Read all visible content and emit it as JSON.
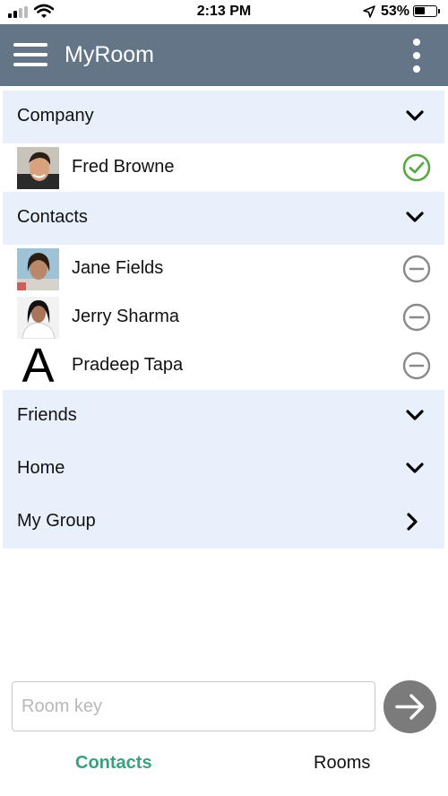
{
  "status_bar": {
    "time": "2:13 PM",
    "battery": "53%",
    "battery_level": 0.53
  },
  "app_bar": {
    "title": "MyRoom",
    "menu_icon": "hamburger-menu-icon",
    "overflow_icon": "more-vertical-icon"
  },
  "groups": [
    {
      "label": "Company",
      "expanded": true,
      "contacts": [
        {
          "name": "Fred Browne",
          "status": "online"
        }
      ]
    },
    {
      "label": "Contacts",
      "expanded": true,
      "contacts": [
        {
          "name": "Jane Fields",
          "status": "offline"
        },
        {
          "name": "Jerry Sharma",
          "status": "offline"
        },
        {
          "name": "Pradeep Tapa",
          "status": "offline",
          "initial": "A"
        }
      ]
    },
    {
      "label": "Friends",
      "expanded": false
    },
    {
      "label": "Home",
      "expanded": false
    },
    {
      "label": "My Group",
      "expanded": false,
      "chevron": "right"
    }
  ],
  "room_key": {
    "placeholder": "Room key",
    "value": ""
  },
  "tabs": [
    {
      "label": "Contacts",
      "active": true
    },
    {
      "label": "Rooms",
      "active": false
    }
  ],
  "colors": {
    "app_bar": "#637587",
    "group_header_bg": "#e8f1fb",
    "online": "#5aa844",
    "offline": "#8a8a8a",
    "active_tab": "#3aa17e",
    "go_button": "#7b7b7b"
  }
}
